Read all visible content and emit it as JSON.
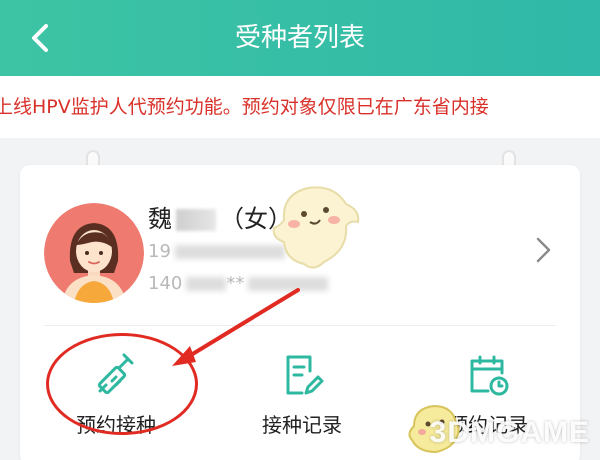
{
  "header": {
    "title": "受种者列表"
  },
  "notice": {
    "text": "上线HPV监护人代预约功能。预约对象仅限已在广东省内接"
  },
  "person": {
    "name_first": "魏",
    "name_suffix": "（女）",
    "line1_prefix": "19",
    "line2_prefix": "140",
    "line2_mask": "**"
  },
  "actions": [
    {
      "label": "预约接种",
      "icon": "syringe-icon"
    },
    {
      "label": "接种记录",
      "icon": "record-edit-icon"
    },
    {
      "label": "预约记录",
      "icon": "calendar-clock-icon"
    }
  ],
  "watermark": {
    "text": "3DMGAME"
  },
  "colors": {
    "header": "#3dc4a4",
    "accent": "#2fb8a0",
    "notice": "#d9312a",
    "annotation": "#e02a22"
  }
}
